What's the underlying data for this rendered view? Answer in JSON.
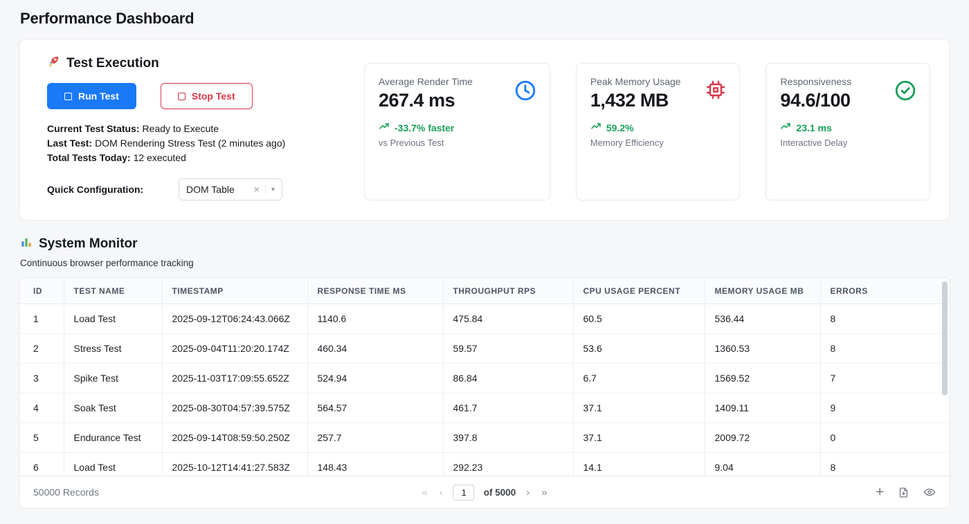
{
  "page": {
    "title": "Performance Dashboard"
  },
  "icons": {
    "first": "«",
    "prev": "‹",
    "next": "›",
    "last": "»",
    "plus": "+",
    "clear": "×",
    "caret": "▾"
  },
  "colors": {
    "accent_blue": "#1a79f7",
    "danger_red": "#d6374a",
    "success_green": "#18a058"
  },
  "test_execution": {
    "title": "Test Execution",
    "run_button": "Run Test",
    "stop_button": "Stop Test",
    "status_label": "Current Test Status:",
    "status_value": "Ready to Execute",
    "last_test_label": "Last Test:",
    "last_test_value": "DOM Rendering Stress Test (2 minutes ago)",
    "total_label": "Total Tests Today:",
    "total_value": "12 executed",
    "quick_config_label": "Quick Configuration:",
    "quick_config_value": "DOM Table"
  },
  "metrics": [
    {
      "label": "Average Render Time",
      "value": "267.4 ms",
      "trend": "-33.7% faster",
      "sub": "vs Previous Test"
    },
    {
      "label": "Peak Memory Usage",
      "value": "1,432 MB",
      "trend": "59.2%",
      "sub": "Memory Efficiency"
    },
    {
      "label": "Responsiveness",
      "value": "94.6/100",
      "trend": "23.1 ms",
      "sub": "Interactive Delay"
    }
  ],
  "system_monitor": {
    "title": "System Monitor",
    "subtitle": "Continuous browser performance tracking",
    "columns": [
      "ID",
      "TEST NAME",
      "TIMESTAMP",
      "RESPONSE TIME MS",
      "THROUGHPUT RPS",
      "CPU USAGE PERCENT",
      "MEMORY USAGE MB",
      "ERRORS"
    ],
    "rows": [
      [
        "1",
        "Load Test",
        "2025-09-12T06:24:43.066Z",
        "1140.6",
        "475.84",
        "60.5",
        "536.44",
        "8"
      ],
      [
        "2",
        "Stress Test",
        "2025-09-04T11:20:20.174Z",
        "460.34",
        "59.57",
        "53.6",
        "1360.53",
        "8"
      ],
      [
        "3",
        "Spike Test",
        "2025-11-03T17:09:55.652Z",
        "524.94",
        "86.84",
        "6.7",
        "1569.52",
        "7"
      ],
      [
        "4",
        "Soak Test",
        "2025-08-30T04:57:39.575Z",
        "564.57",
        "461.7",
        "37.1",
        "1409.11",
        "9"
      ],
      [
        "5",
        "Endurance Test",
        "2025-09-14T08:59:50.250Z",
        "257.7",
        "397.8",
        "37.1",
        "2009.72",
        "0"
      ],
      [
        "6",
        "Load Test",
        "2025-10-12T14:41:27.583Z",
        "148.43",
        "292.23",
        "14.1",
        "9.04",
        "8"
      ]
    ],
    "footer": {
      "records": "50000 Records",
      "page": "1",
      "of_label": "of 5000"
    }
  }
}
